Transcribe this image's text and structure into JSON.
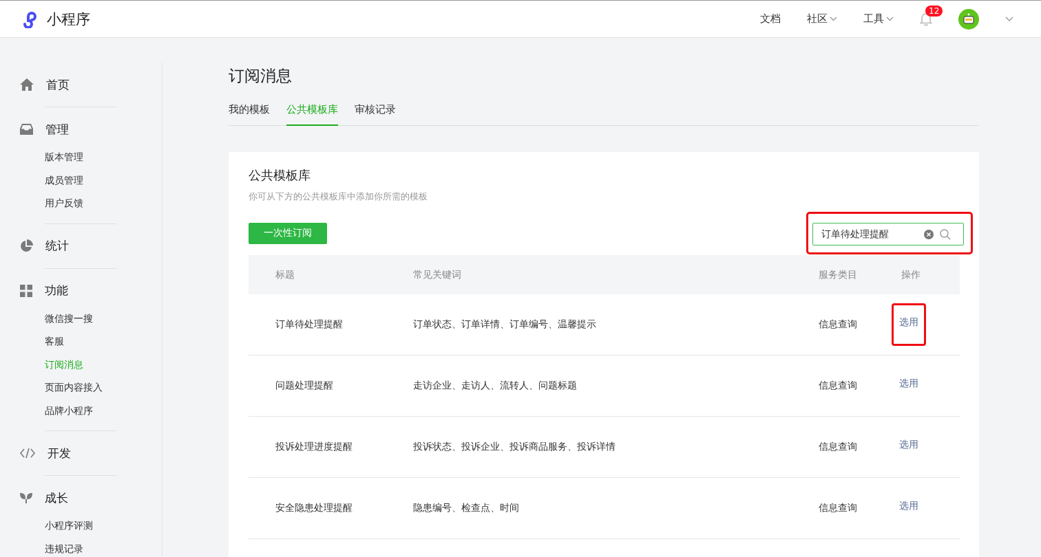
{
  "header": {
    "logo_text": "小程序",
    "nav": [
      {
        "label": "文档",
        "dropdown": false
      },
      {
        "label": "社区",
        "dropdown": true
      },
      {
        "label": "工具",
        "dropdown": true
      }
    ],
    "notification_count": "12"
  },
  "sidebar": {
    "sections": [
      {
        "label": "首页"
      },
      {
        "label": "管理",
        "items": [
          {
            "label": "版本管理",
            "selected": false
          },
          {
            "label": "成员管理",
            "selected": false
          },
          {
            "label": "用户反馈",
            "selected": false
          }
        ]
      },
      {
        "label": "统计"
      },
      {
        "label": "功能",
        "items": [
          {
            "label": "微信搜一搜",
            "selected": false
          },
          {
            "label": "客服",
            "selected": false
          },
          {
            "label": "订阅消息",
            "selected": true
          },
          {
            "label": "页面内容接入",
            "selected": false
          },
          {
            "label": "品牌小程序",
            "selected": false
          }
        ]
      },
      {
        "label": "开发"
      },
      {
        "label": "成长",
        "items": [
          {
            "label": "小程序评测",
            "selected": false
          },
          {
            "label": "违规记录",
            "selected": false
          }
        ]
      }
    ]
  },
  "page_title": "订阅消息",
  "tabs": [
    {
      "label": "我的模板",
      "selected": false
    },
    {
      "label": "公共模板库",
      "selected": true
    },
    {
      "label": "审核记录",
      "selected": false
    }
  ],
  "card": {
    "title": "公共模板库",
    "subtitle": "你可从下方的公共模板库中添加你所需的模板",
    "button": "一次性订阅",
    "search": {
      "value": "订单待处理提醒",
      "highlighted": true
    },
    "table": {
      "columns": [
        "标题",
        "常见关键词",
        "服务类目",
        "操作"
      ],
      "rows": [
        {
          "title": "订单待处理提醒",
          "keywords": "订单状态、订单详情、订单编号、温馨提示",
          "category": "信息查询",
          "action": "选用",
          "highlighted": true
        },
        {
          "title": "问题处理提醒",
          "keywords": "走访企业、走访人、流转人、问题标题",
          "category": "信息查询",
          "action": "选用",
          "highlighted": false
        },
        {
          "title": "投诉处理进度提醒",
          "keywords": "投诉状态、投诉企业、投诉商品服务、投诉详情",
          "category": "信息查询",
          "action": "选用",
          "highlighted": false
        },
        {
          "title": "安全隐患处理提醒",
          "keywords": "隐患编号、检查点、时间",
          "category": "信息查询",
          "action": "选用",
          "highlighted": false
        }
      ]
    }
  }
}
